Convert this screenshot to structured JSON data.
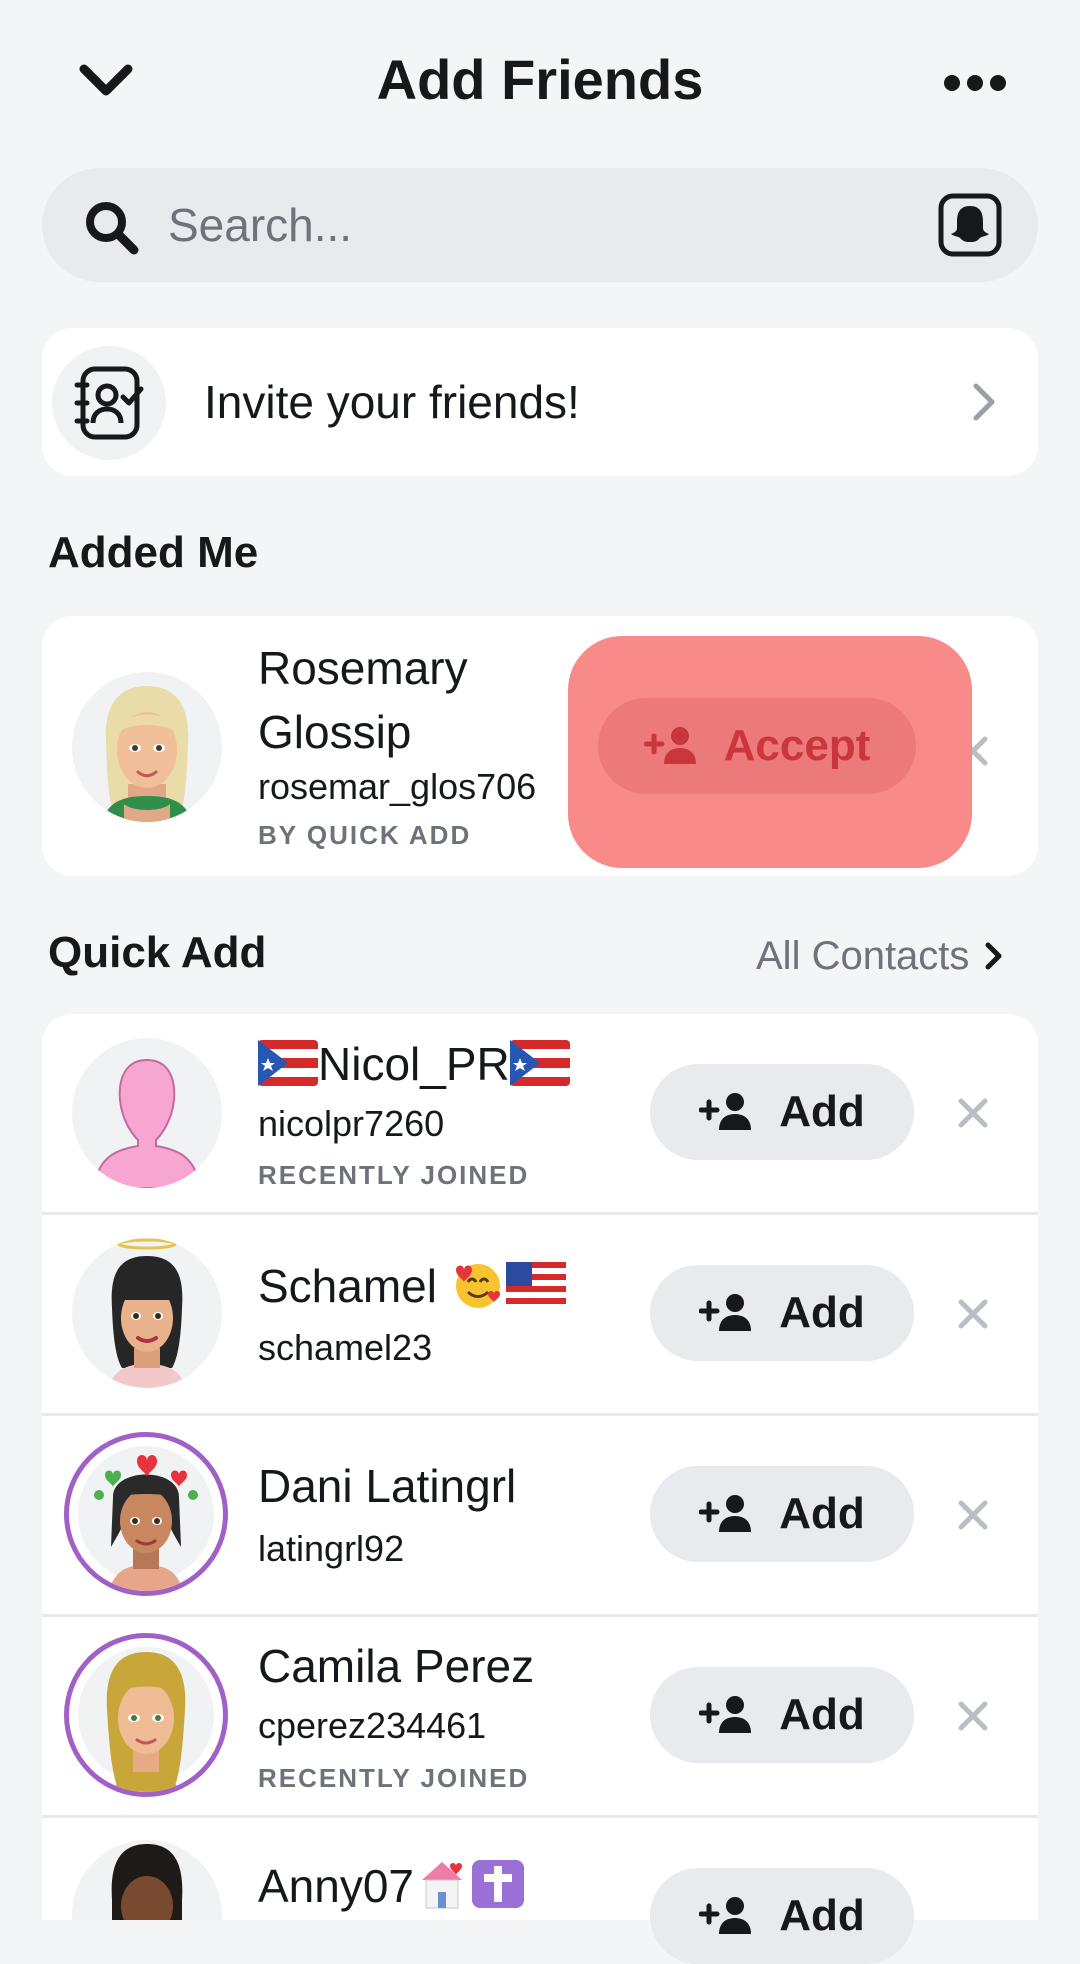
{
  "header": {
    "title": "Add Friends",
    "back_icon": "chevron-down-icon",
    "more_icon": "more-horizontal-icon"
  },
  "search": {
    "placeholder": "Search...",
    "scan_icon": "snapcode-scan-icon"
  },
  "invite": {
    "label": "Invite your friends!",
    "icon": "contacts-book-icon"
  },
  "added_me": {
    "section_title": "Added Me",
    "items": [
      {
        "name_line1": "Rosemary",
        "name_line2": "Glossip",
        "username": "rosemar_glos706",
        "reason": "BY QUICK ADD",
        "accept_label": "Accept"
      }
    ]
  },
  "quick_add": {
    "section_title": "Quick Add",
    "all_contacts_label": "All Contacts",
    "add_label": "Add",
    "items": [
      {
        "name": "Nicol_PR",
        "username": "nicolpr7260",
        "reason": "RECENTLY JOINED"
      },
      {
        "name": "Schamel",
        "username": "schamel23",
        "reason": ""
      },
      {
        "name": "Dani Latingrl",
        "username": "latingrl92",
        "reason": ""
      },
      {
        "name": "Camila Perez",
        "username": "cperez234461",
        "reason": "RECENTLY JOINED"
      },
      {
        "name": "Anny07",
        "username": "",
        "reason": ""
      }
    ]
  },
  "colors": {
    "background": "#f3f5f7",
    "button_bg": "#e8eaed",
    "highlight": "#f98a8a",
    "accept_text": "#c9373d",
    "story_ring": "#a060c6",
    "secondary_text": "#6d737a"
  }
}
